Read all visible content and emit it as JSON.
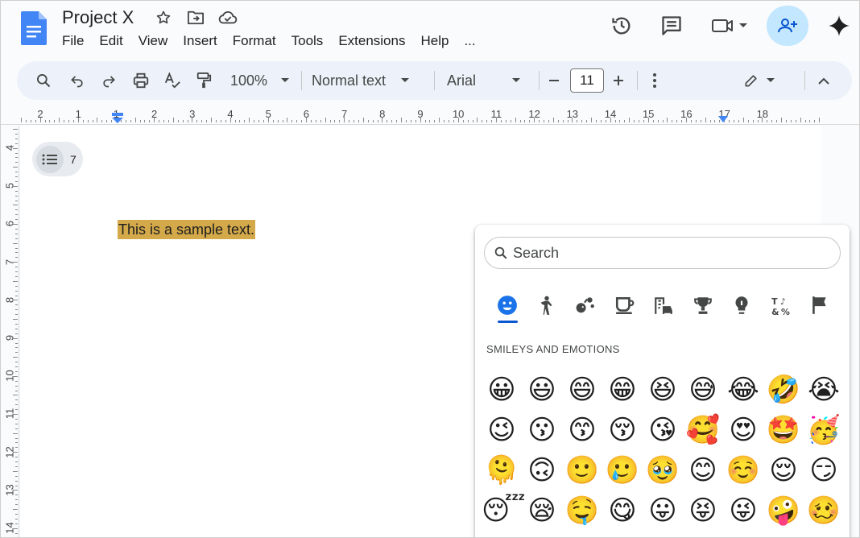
{
  "app": {
    "doc_title": "Project X",
    "menus": [
      "File",
      "Edit",
      "View",
      "Insert",
      "Format",
      "Tools",
      "Extensions",
      "Help",
      "..."
    ]
  },
  "toolbar": {
    "zoom": "100%",
    "style": "Normal text",
    "font": "Arial",
    "font_size": "11"
  },
  "ruler": {
    "labels": [
      "2",
      "1",
      "1",
      "2",
      "3",
      "4",
      "5",
      "6",
      "7",
      "8",
      "9",
      "10",
      "11",
      "12",
      "13",
      "14",
      "15",
      "16",
      "17",
      "18"
    ],
    "vertical_labels": [
      "4",
      "5",
      "6",
      "7",
      "8",
      "9",
      "10",
      "11",
      "12",
      "13",
      "14"
    ]
  },
  "document": {
    "outline_count": "7",
    "sample_text": "This is a sample text."
  },
  "picker": {
    "search_placeholder": "Search",
    "section_title": "SMILEYS AND EMOTIONS",
    "categories": [
      "smileys-icon",
      "people-icon",
      "animals-icon",
      "food-icon",
      "travel-icon",
      "activities-icon",
      "objects-icon",
      "symbols-icon",
      "flags-icon"
    ],
    "active_category": "smileys-icon",
    "emojis": [
      "😀",
      "😃",
      "😄",
      "😁",
      "😆",
      "😅",
      "😂",
      "🤣",
      "😭",
      "😉",
      "😗",
      "😙",
      "😚",
      "😘",
      "🥰",
      "😍",
      "🤩",
      "🥳",
      "🫠",
      "🙃",
      "🙂",
      "🥲",
      "🥹",
      "😊",
      "☺️",
      "😌",
      "😏",
      "😴",
      "😪",
      "🤤",
      "😋",
      "😛",
      "😝",
      "😜",
      "🤪",
      "🥴"
    ]
  },
  "colors": {
    "accent": "#0b57d0",
    "share_bg": "#c2e7ff",
    "toolbar_bg": "#edf2fa",
    "highlight": "#d4a94a"
  }
}
